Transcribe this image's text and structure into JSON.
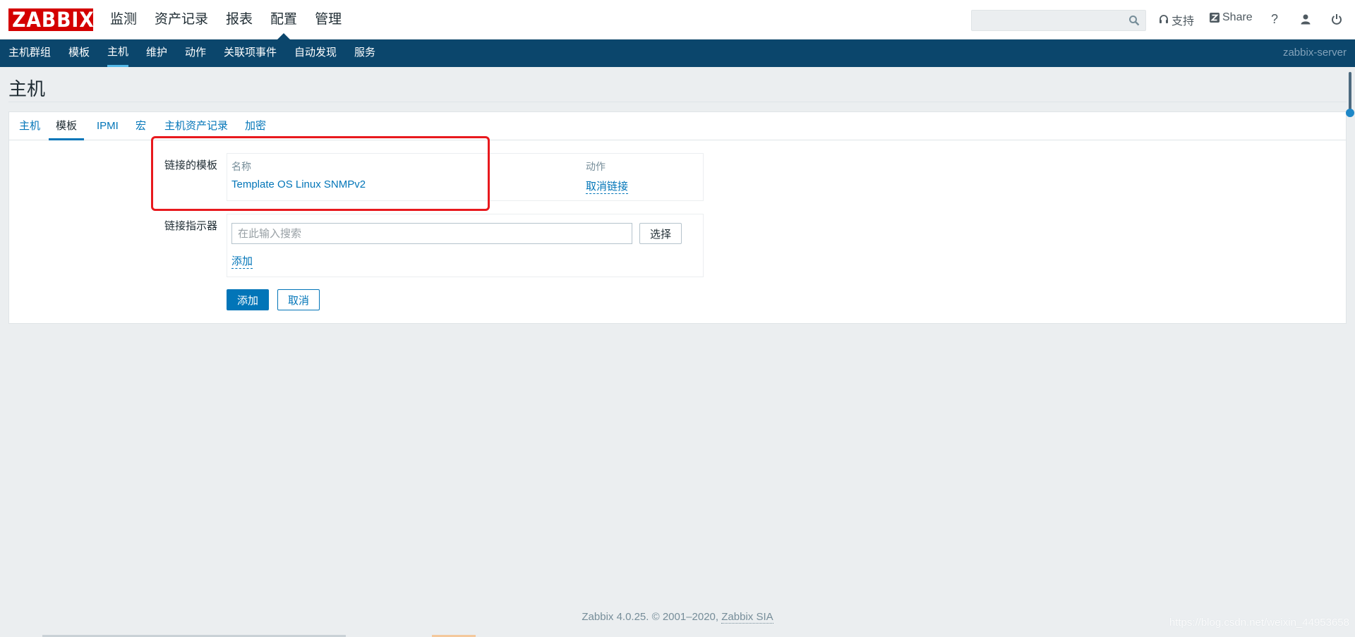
{
  "header": {
    "logo_text": "ZABBIX",
    "menu": [
      {
        "label": "监测"
      },
      {
        "label": "资产记录"
      },
      {
        "label": "报表"
      },
      {
        "label": "配置"
      },
      {
        "label": "管理"
      }
    ],
    "active_menu": "配置",
    "search_placeholder": "",
    "support_label": "支持",
    "share_label": "Share",
    "help_label": "?"
  },
  "subnav": {
    "items": [
      {
        "label": "主机群组"
      },
      {
        "label": "模板"
      },
      {
        "label": "主机"
      },
      {
        "label": "维护"
      },
      {
        "label": "动作"
      },
      {
        "label": "关联项事件"
      },
      {
        "label": "自动发现"
      },
      {
        "label": "服务"
      }
    ],
    "active": "主机",
    "server_name": "zabbix-server"
  },
  "page": {
    "title": "主机"
  },
  "tabs": [
    {
      "label": "主机"
    },
    {
      "label": "模板"
    },
    {
      "label": "IPMI"
    },
    {
      "label": "宏"
    },
    {
      "label": "主机资产记录"
    },
    {
      "label": "加密"
    }
  ],
  "active_tab": "模板",
  "form": {
    "linked_templates_label": "链接的模板",
    "col_name": "名称",
    "col_action": "动作",
    "template_name": "Template OS Linux SNMPv2",
    "unlink_label": "取消链接",
    "link_new_label": "链接指示器",
    "search_placeholder": "在此输入搜索",
    "select_label": "选择",
    "add_link_label": "添加",
    "submit_label": "添加",
    "cancel_label": "取消"
  },
  "footer": {
    "text": "Zabbix 4.0.25. © 2001–2020, ",
    "link": "Zabbix SIA"
  },
  "watermark": "https://blog.csdn.net/weixin_44953658",
  "colors": {
    "brand_red": "#d40000",
    "nav_blue": "#0b466c",
    "link_blue": "#0275b8",
    "highlight_red": "#e8191e"
  }
}
